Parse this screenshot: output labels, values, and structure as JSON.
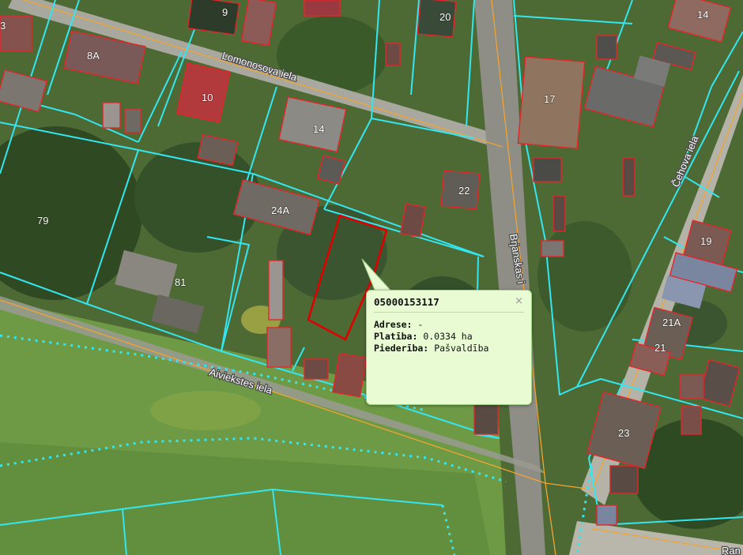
{
  "map": {
    "colors": {
      "parcel_boundary": "#33e6f0",
      "building_outline": "#e2262a",
      "selected_parcel": "#e00000",
      "road": "#f2a431",
      "popup_background": "#e8fbd2"
    },
    "streets": {
      "lomonosova": "Lomonosova iela",
      "alviekstes": "Aiviekstes iela",
      "brjanskas": "Brjanskas i",
      "cehova": "Čehova iela",
      "ran": "Ran"
    },
    "labels": {
      "n9": "9",
      "n20": "20",
      "n14a": "14",
      "n8a": "8A",
      "n10": "10",
      "n17": "17",
      "n14b": "14",
      "n22": "22",
      "n24a": "24A",
      "n79": "79",
      "n81": "81",
      "n19": "19",
      "n21a": "21A",
      "n21": "21",
      "n23": "23",
      "n3": "3"
    }
  },
  "popup": {
    "title": "05000153117",
    "close_icon": "×",
    "address_label": "Adrese:",
    "address_value": "-",
    "area_label": "Platība:",
    "area_value": "0.0334 ha",
    "ownership_label": "Piederība:",
    "ownership_value": "Pašvaldība"
  }
}
